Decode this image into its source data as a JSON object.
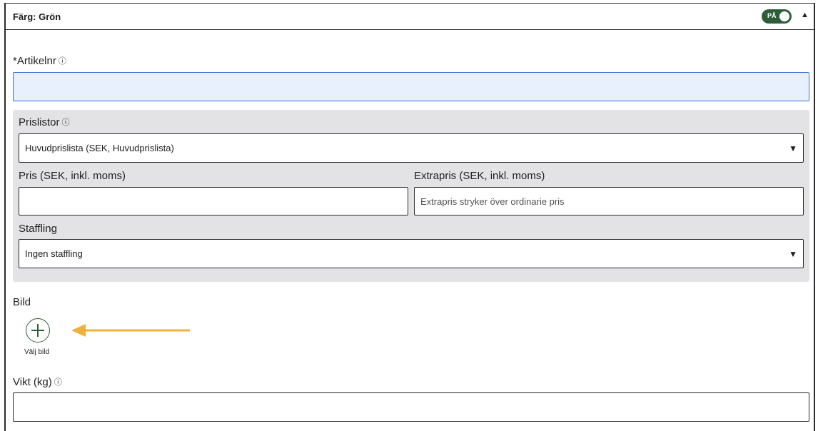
{
  "header": {
    "title": "Färg: Grön",
    "toggle_label": "PÅ",
    "toggle_on": true,
    "collapse_icon": "caret-up-icon"
  },
  "artikelnr": {
    "label": "Artikelnr",
    "required_mark": "*",
    "info_icon": "ⓘ",
    "value": ""
  },
  "prislistor": {
    "label": "Prislistor",
    "info_icon": "ⓘ",
    "selected": "Huvudprislista (SEK, Huvudprislista)",
    "arrow": "▼"
  },
  "pris": {
    "label": "Pris (SEK, inkl. moms)",
    "value": ""
  },
  "extrapris": {
    "label": "Extrapris (SEK, inkl. moms)",
    "placeholder": "Extrapris stryker över ordinarie pris"
  },
  "staffling": {
    "label": "Staffling",
    "selected": "Ingen staffling",
    "arrow": "▼"
  },
  "bild": {
    "label": "Bild",
    "button_label": "Välj bild"
  },
  "vikt": {
    "label": "Vikt (kg)",
    "info_icon": "ⓘ",
    "value": ""
  },
  "colors": {
    "accent_green": "#2f5d3a",
    "arrow_annotation": "#f0b03a",
    "panel_bg": "#e3e3e6",
    "focus_bg": "#e8f0fe"
  }
}
